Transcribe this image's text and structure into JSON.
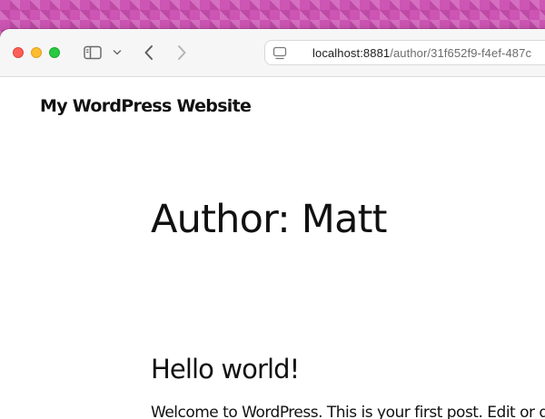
{
  "browser": {
    "url_host": "localhost:8881",
    "url_path": "/author/31f652f9-f4ef-487c",
    "icons": {
      "window_controls": [
        "close",
        "minimize",
        "zoom"
      ],
      "sidebar_toggle": "sidebar-icon",
      "sidebar_menu": "chevron-down-icon",
      "back": "chevron-left-icon",
      "forward": "chevron-right-icon",
      "page_settings": "page-icon"
    },
    "colors": {
      "close": "#fe5f57",
      "minimize": "#febc2e",
      "zoom": "#28c840",
      "desktop": "#cd55b4"
    }
  },
  "site": {
    "title": "My WordPress Website"
  },
  "archive": {
    "title": "Author: Matt"
  },
  "posts": [
    {
      "title": "Hello world!",
      "excerpt": "Welcome to WordPress. This is your first post. Edit or delete it"
    }
  ]
}
